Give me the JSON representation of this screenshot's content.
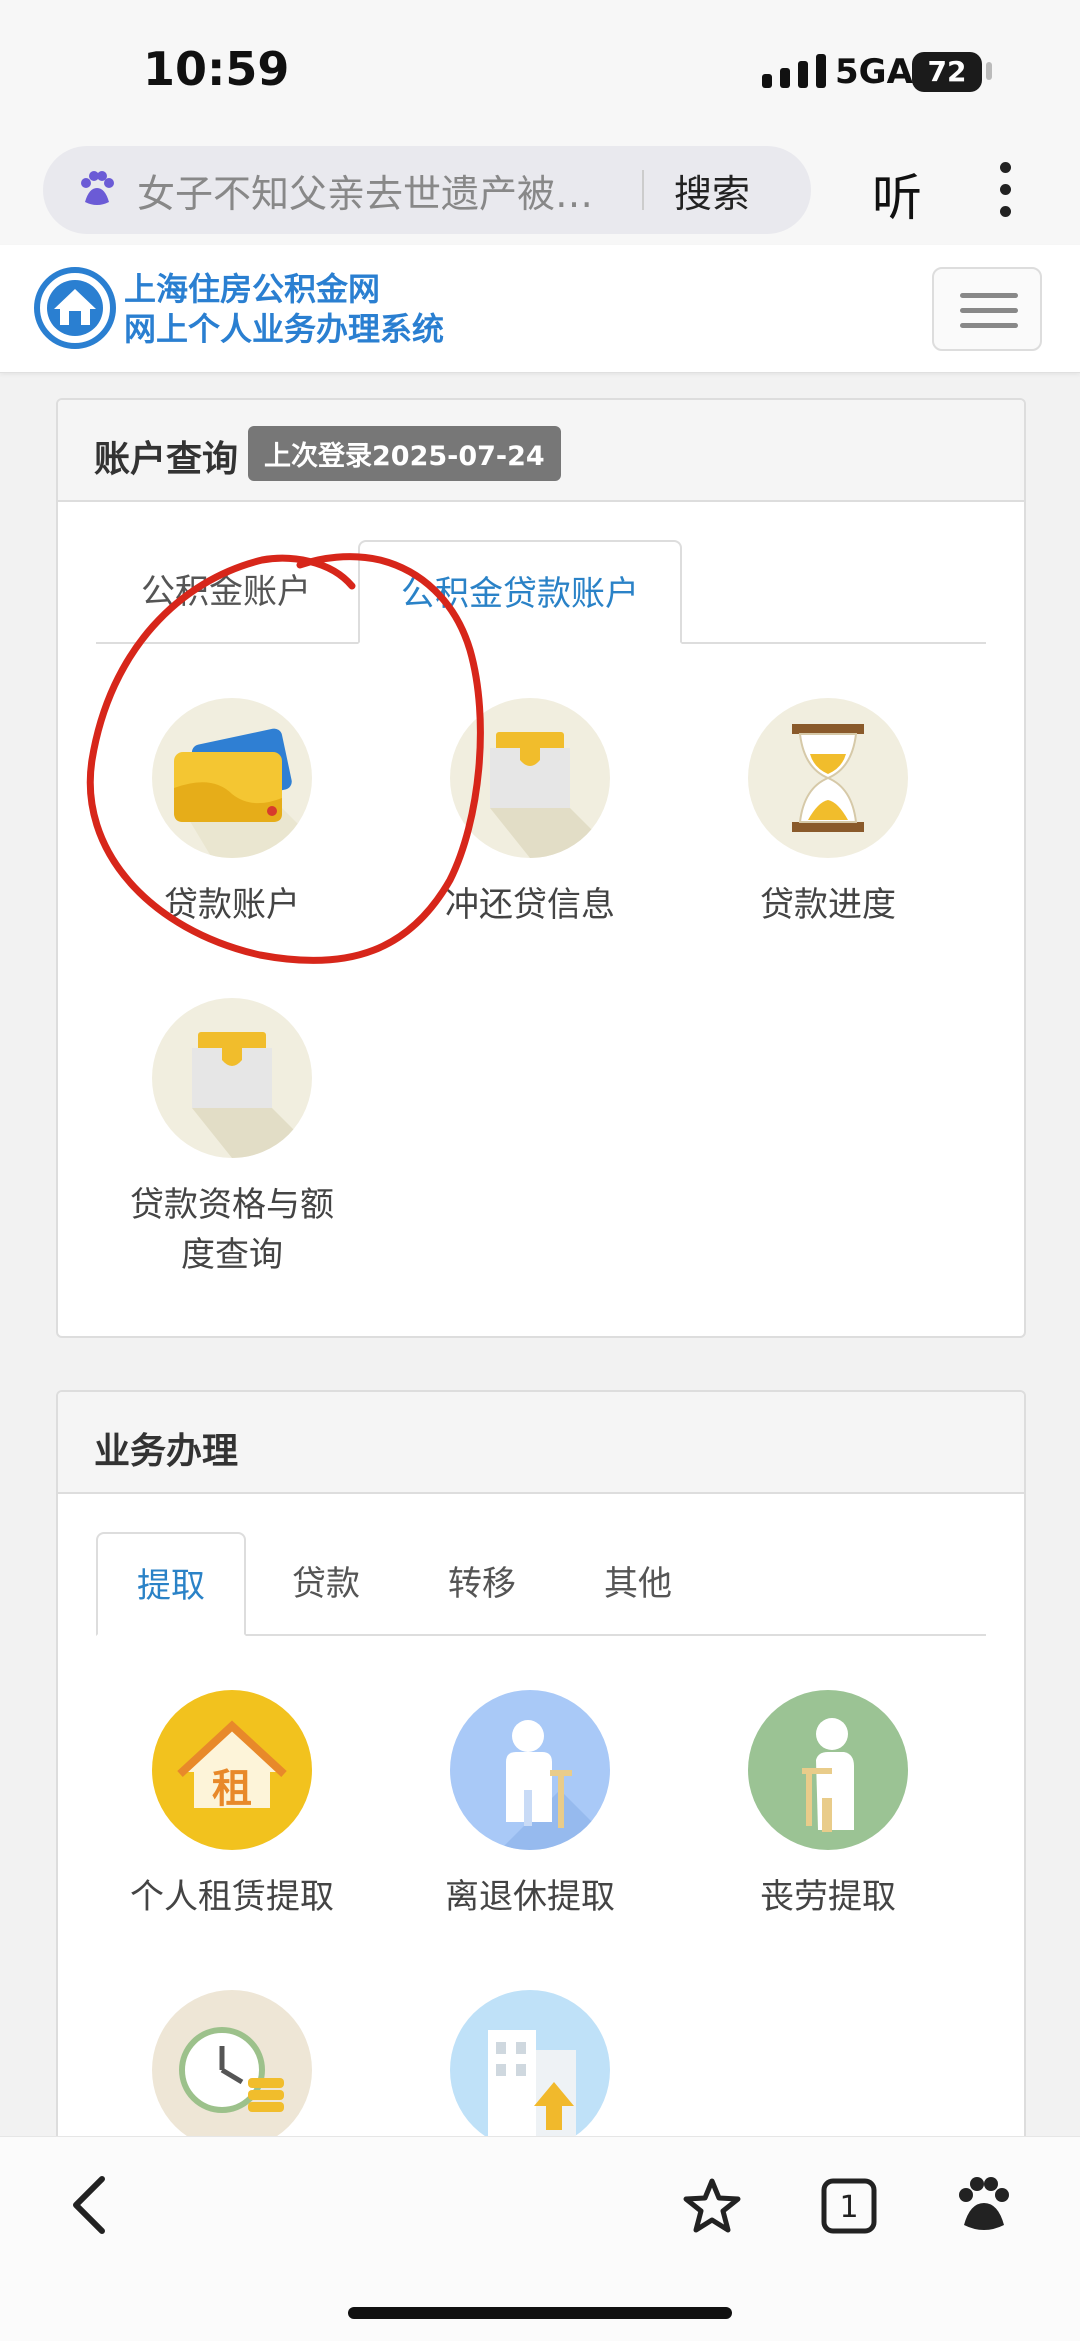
{
  "status_bar": {
    "time": "10:59",
    "network": "5GA",
    "battery": "72"
  },
  "browser": {
    "search_query": "女子不知父亲去世遗产被…",
    "search_button": "搜索",
    "listen_label": "听"
  },
  "site": {
    "name_line1": "上海住房公积金网",
    "name_line2": "网上个人业务办理系统"
  },
  "account_panel": {
    "title": "账户查询",
    "last_login": "上次登录2025-07-24",
    "tabs": [
      "公积金账户",
      "公积金贷款账户"
    ],
    "active_tab": "公积金贷款账户",
    "items": [
      "贷款账户",
      "冲还贷信息",
      "贷款进度",
      "贷款资格与额度查询"
    ]
  },
  "business_panel": {
    "title": "业务办理",
    "tabs": [
      "提取",
      "贷款",
      "转移",
      "其他"
    ],
    "active_tab": "提取",
    "items": [
      "个人租赁提取",
      "离退休提取",
      "丧劳提取"
    ],
    "rent_glyph": "租"
  },
  "colors": {
    "link_blue": "#2a82c7",
    "brand_blue": "#2a7fd1",
    "annotation_red": "#d7261a"
  }
}
